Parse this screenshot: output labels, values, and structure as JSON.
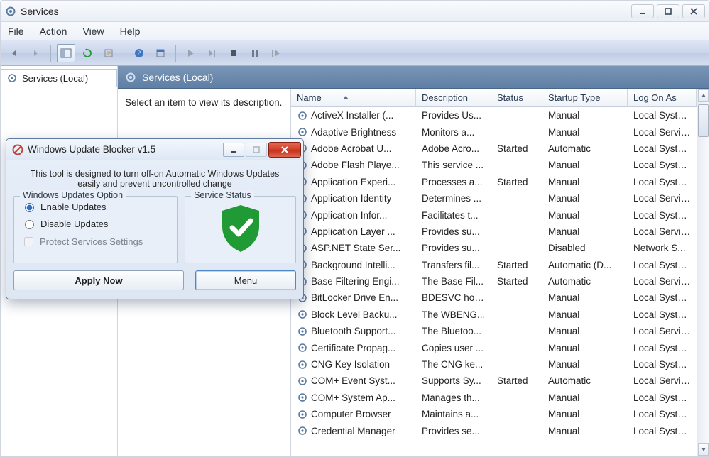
{
  "services": {
    "window_title": "Services",
    "menu": {
      "file": "File",
      "action": "Action",
      "view": "View",
      "help": "Help"
    },
    "left_tab": "Services (Local)",
    "right_header": "Services (Local)",
    "description": "Select an item to view its description.",
    "columns": {
      "name": "Name",
      "description": "Description",
      "status": "Status",
      "startup": "Startup Type",
      "logon": "Log On As"
    },
    "rows": [
      {
        "name": "ActiveX Installer (...",
        "desc": "Provides Us...",
        "status": "",
        "start": "Manual",
        "logon": "Local Syste..."
      },
      {
        "name": "Adaptive Brightness",
        "desc": "Monitors a...",
        "status": "",
        "start": "Manual",
        "logon": "Local Service"
      },
      {
        "name": "Adobe Acrobat U...",
        "desc": "Adobe Acro...",
        "status": "Started",
        "start": "Automatic",
        "logon": "Local Syste..."
      },
      {
        "name": "Adobe Flash Playe...",
        "desc": "This service ...",
        "status": "",
        "start": "Manual",
        "logon": "Local Syste..."
      },
      {
        "name": "Application Experi...",
        "desc": "Processes a...",
        "status": "Started",
        "start": "Manual",
        "logon": "Local Syste..."
      },
      {
        "name": "Application Identity",
        "desc": "Determines ...",
        "status": "",
        "start": "Manual",
        "logon": "Local Service"
      },
      {
        "name": "Application Infor...",
        "desc": "Facilitates t...",
        "status": "",
        "start": "Manual",
        "logon": "Local Syste..."
      },
      {
        "name": "Application Layer ...",
        "desc": "Provides su...",
        "status": "",
        "start": "Manual",
        "logon": "Local Service"
      },
      {
        "name": "ASP.NET State Ser...",
        "desc": "Provides su...",
        "status": "",
        "start": "Disabled",
        "logon": "Network S..."
      },
      {
        "name": "Background Intelli...",
        "desc": "Transfers fil...",
        "status": "Started",
        "start": "Automatic (D...",
        "logon": "Local Syste..."
      },
      {
        "name": "Base Filtering Engi...",
        "desc": "The Base Fil...",
        "status": "Started",
        "start": "Automatic",
        "logon": "Local Service"
      },
      {
        "name": "BitLocker Drive En...",
        "desc": "BDESVC hos...",
        "status": "",
        "start": "Manual",
        "logon": "Local Syste..."
      },
      {
        "name": "Block Level Backu...",
        "desc": "The WBENG...",
        "status": "",
        "start": "Manual",
        "logon": "Local Syste..."
      },
      {
        "name": "Bluetooth Support...",
        "desc": "The Bluetoo...",
        "status": "",
        "start": "Manual",
        "logon": "Local Service"
      },
      {
        "name": "Certificate Propag...",
        "desc": "Copies user ...",
        "status": "",
        "start": "Manual",
        "logon": "Local Syste..."
      },
      {
        "name": "CNG Key Isolation",
        "desc": "The CNG ke...",
        "status": "",
        "start": "Manual",
        "logon": "Local Syste..."
      },
      {
        "name": "COM+ Event Syst...",
        "desc": "Supports Sy...",
        "status": "Started",
        "start": "Automatic",
        "logon": "Local Service"
      },
      {
        "name": "COM+ System Ap...",
        "desc": "Manages th...",
        "status": "",
        "start": "Manual",
        "logon": "Local Syste..."
      },
      {
        "name": "Computer Browser",
        "desc": "Maintains a...",
        "status": "",
        "start": "Manual",
        "logon": "Local Syste..."
      },
      {
        "name": "Credential Manager",
        "desc": "Provides se...",
        "status": "",
        "start": "Manual",
        "logon": "Local Syste..."
      }
    ]
  },
  "wub": {
    "title": "Windows Update Blocker v1.5",
    "description": "This tool is designed to turn off-on Automatic Windows Updates easily and prevent uncontrolled change",
    "group_options": "Windows Updates Option",
    "group_status": "Service Status",
    "opt_enable": "Enable Updates",
    "opt_disable": "Disable Updates",
    "opt_protect": "Protect Services Settings",
    "btn_apply": "Apply Now",
    "btn_menu": "Menu"
  }
}
